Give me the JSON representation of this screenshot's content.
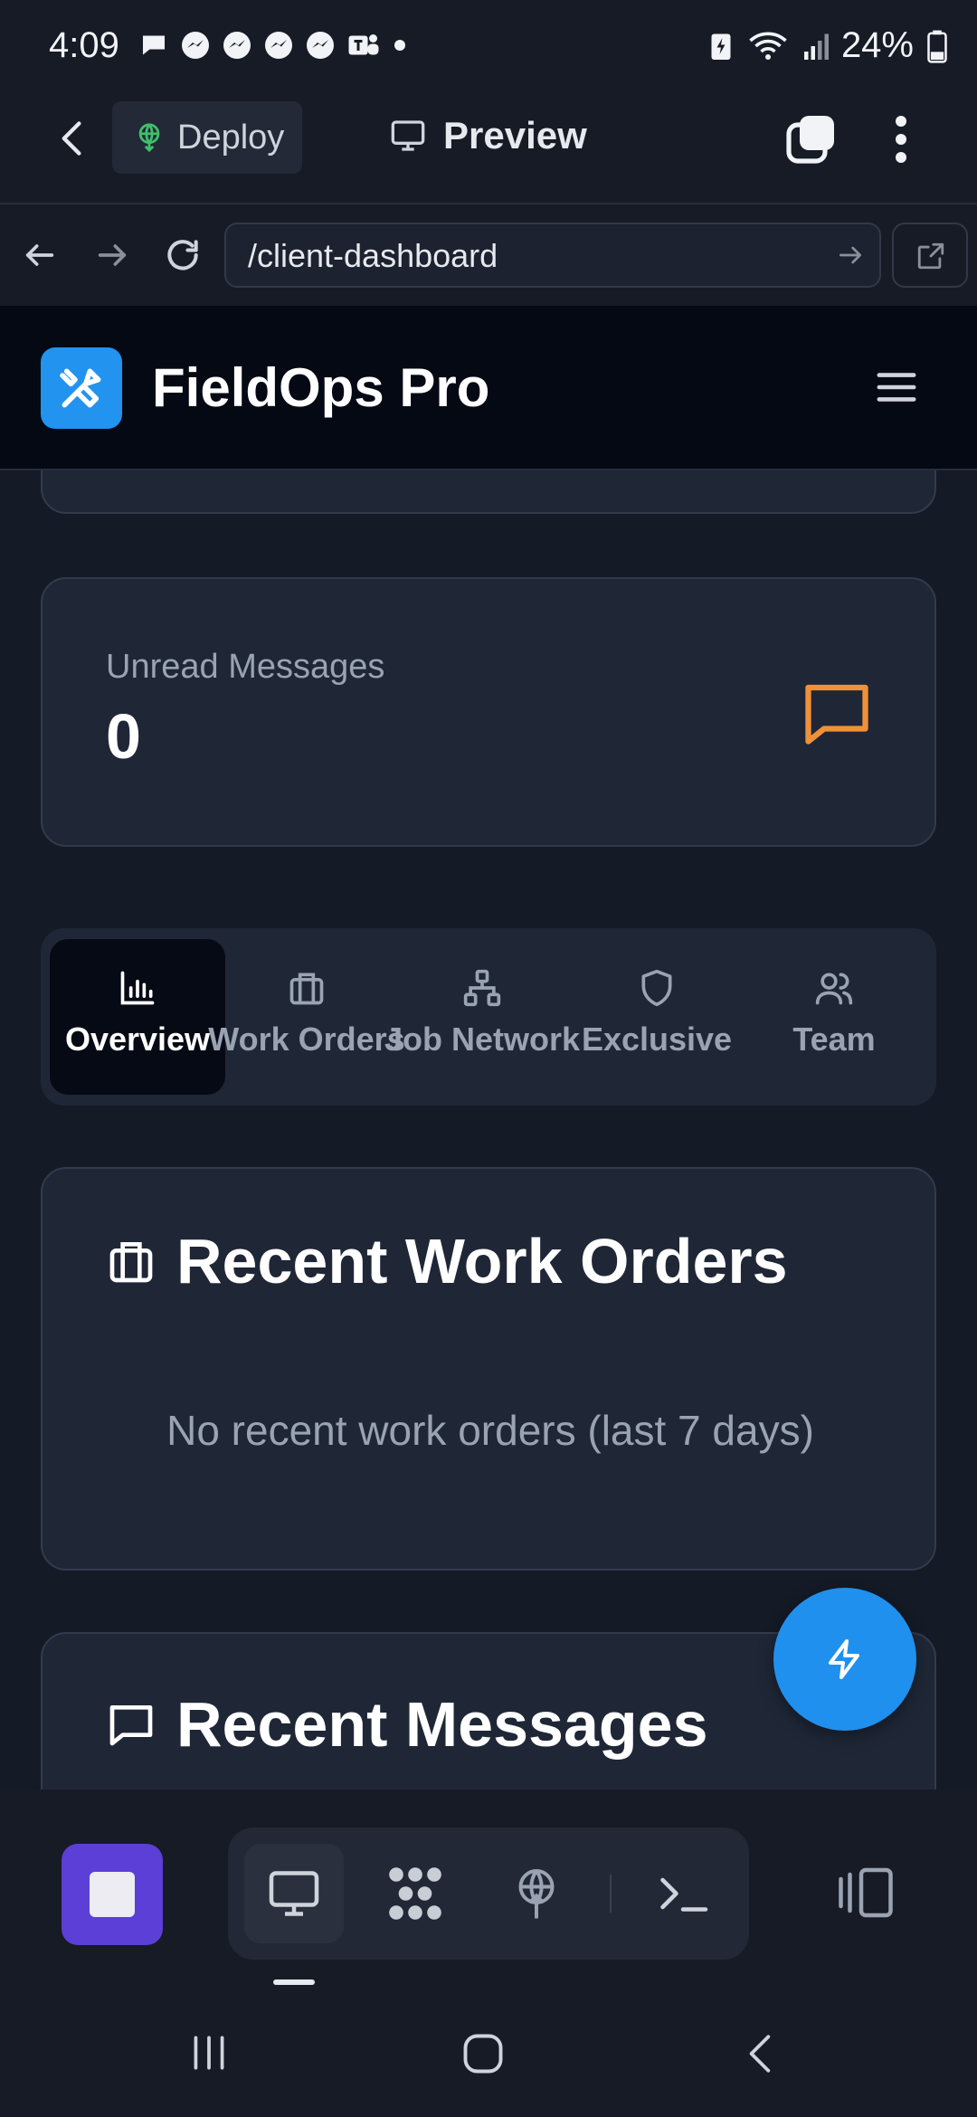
{
  "status_bar": {
    "time": "4:09",
    "battery": "24%",
    "notification_icons": [
      "chat-bubble-icon",
      "messenger-icon",
      "messenger-icon",
      "messenger-icon",
      "messenger-icon",
      "teams-icon",
      "dot-icon"
    ]
  },
  "toolbar": {
    "deploy_label": "Deploy",
    "preview_label": "Preview"
  },
  "url_bar": {
    "value": "/client-dashboard"
  },
  "app": {
    "brand": "FieldOps Pro",
    "accent": "#2293ee"
  },
  "stats": {
    "unread_label": "Unread Messages",
    "unread_value": "0",
    "icon_color": "#f0913a"
  },
  "tabs": [
    {
      "label": "Overview",
      "icon": "bar-chart-icon",
      "active": true
    },
    {
      "label": "Work Orders",
      "icon": "briefcase-icon",
      "active": false
    },
    {
      "label": "Job Network",
      "icon": "network-icon",
      "active": false
    },
    {
      "label": "Exclusive",
      "icon": "shield-icon",
      "active": false
    },
    {
      "label": "Team",
      "icon": "users-icon",
      "active": false
    }
  ],
  "recent_work_orders": {
    "title": "Recent Work Orders",
    "empty_text": "No recent work orders (last 7 days)"
  },
  "recent_messages": {
    "title": "Recent Messages"
  },
  "ide_bar": {
    "stop_color": "#5b3fd6"
  }
}
